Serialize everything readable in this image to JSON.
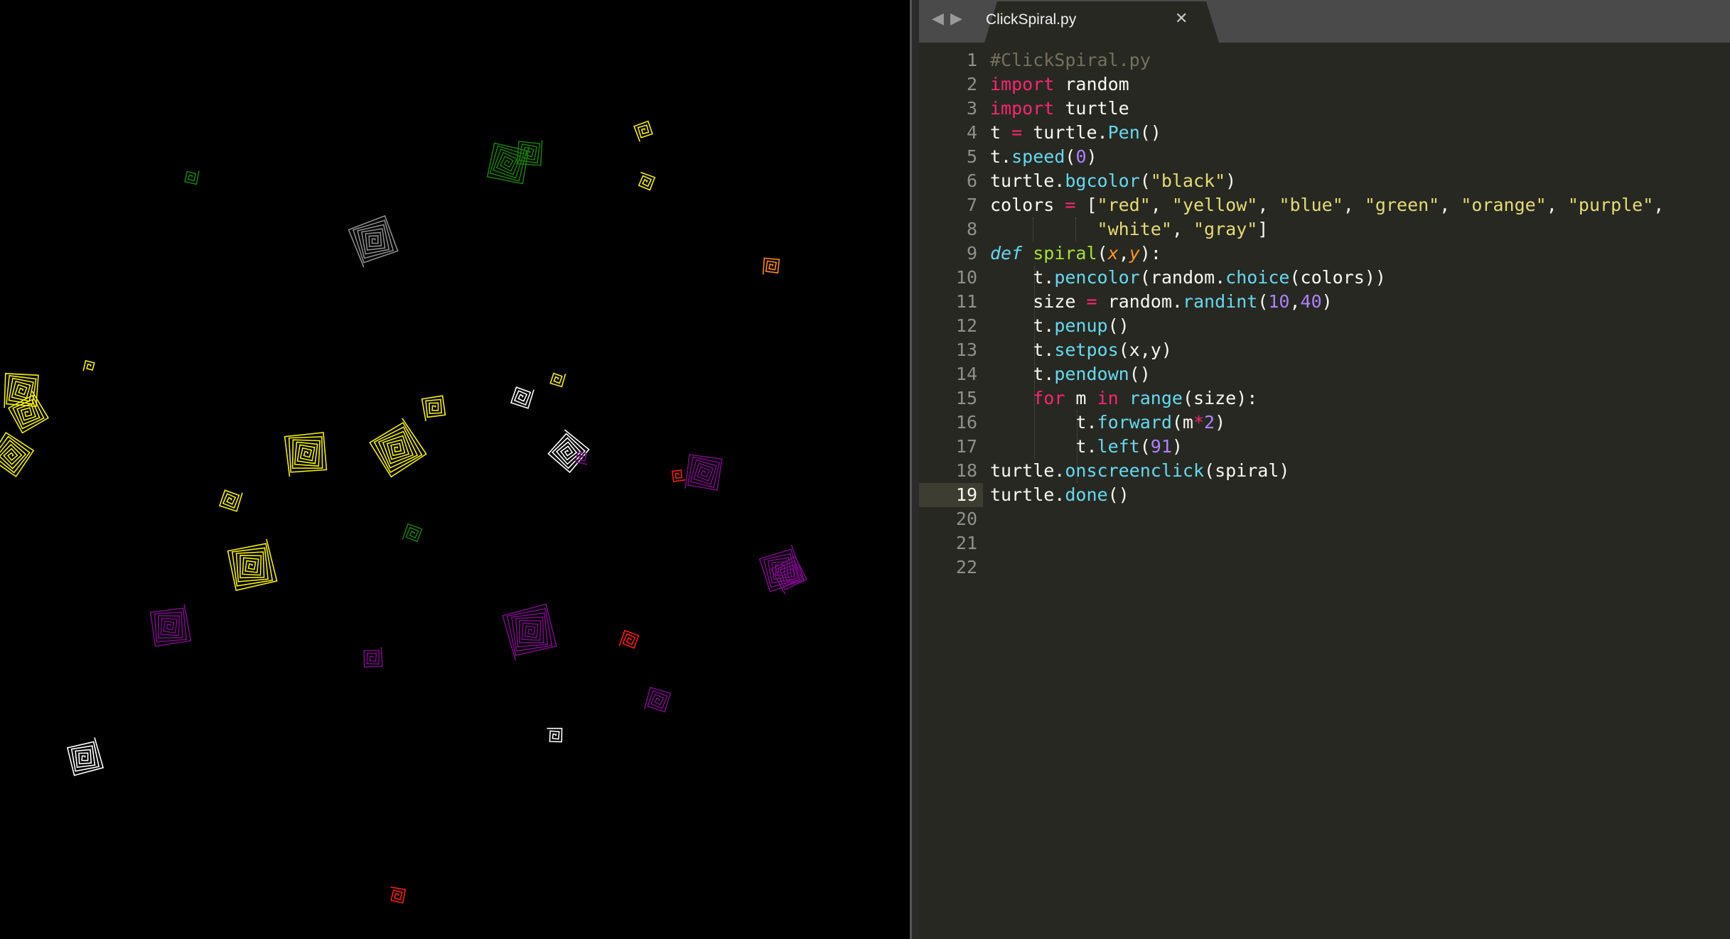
{
  "canvas": {
    "background": "#000000",
    "spiral_colors": {
      "red": "#ff1a1a",
      "yellow": "#f5f000",
      "green": "#1a7a0a",
      "orange": "#ff8c00",
      "purple": "#7a0a86",
      "white": "#ffffff",
      "gray": "#8c8c8c"
    }
  },
  "editor": {
    "tab": {
      "title": "ClickSpiral.py",
      "close_icon": "close-icon",
      "back_icon": "triangle-left-icon",
      "forward_icon": "triangle-right-icon"
    },
    "active_line": 19,
    "line_numbers": [
      "1",
      "2",
      "3",
      "4",
      "5",
      "6",
      "7",
      "8",
      "9",
      "10",
      "11",
      "12",
      "13",
      "14",
      "15",
      "16",
      "17",
      "18",
      "19",
      "20",
      "21",
      "22"
    ],
    "lines": [
      [
        [
          "comment",
          "#ClickSpiral.py"
        ]
      ],
      [
        [
          "keyword",
          "import"
        ],
        [
          "text",
          " random"
        ]
      ],
      [
        [
          "keyword",
          "import"
        ],
        [
          "text",
          " turtle"
        ]
      ],
      [
        [
          "text",
          "t "
        ],
        [
          "keyword",
          "="
        ],
        [
          "text",
          " turtle."
        ],
        [
          "func",
          "Pen"
        ],
        [
          "text",
          "()"
        ]
      ],
      [
        [
          "text",
          "t."
        ],
        [
          "func",
          "speed"
        ],
        [
          "text",
          "("
        ],
        [
          "number",
          "0"
        ],
        [
          "text",
          ")"
        ]
      ],
      [
        [
          "text",
          "turtle."
        ],
        [
          "func",
          "bgcolor"
        ],
        [
          "text",
          "("
        ],
        [
          "string",
          "\"black\""
        ],
        [
          "text",
          ")"
        ]
      ],
      [
        [
          "text",
          "colors "
        ],
        [
          "keyword",
          "="
        ],
        [
          "text",
          " ["
        ],
        [
          "string",
          "\"red\""
        ],
        [
          "text",
          ", "
        ],
        [
          "string",
          "\"yellow\""
        ],
        [
          "text",
          ", "
        ],
        [
          "string",
          "\"blue\""
        ],
        [
          "text",
          ", "
        ],
        [
          "string",
          "\"green\""
        ],
        [
          "text",
          ", "
        ],
        [
          "string",
          "\"orange\""
        ],
        [
          "text",
          ", "
        ],
        [
          "string",
          "\"purple\""
        ],
        [
          "text",
          ","
        ]
      ],
      [
        [
          "text",
          "          "
        ],
        [
          "string",
          "\"white\""
        ],
        [
          "text",
          ", "
        ],
        [
          "string",
          "\"gray\""
        ],
        [
          "text",
          "]"
        ]
      ],
      [
        [
          "storage",
          "def"
        ],
        [
          "text",
          " "
        ],
        [
          "defname",
          "spiral"
        ],
        [
          "text",
          "("
        ],
        [
          "param",
          "x"
        ],
        [
          "text",
          ","
        ],
        [
          "param",
          "y"
        ],
        [
          "text",
          "):"
        ]
      ],
      [
        [
          "text",
          "    t."
        ],
        [
          "func",
          "pencolor"
        ],
        [
          "text",
          "(random."
        ],
        [
          "func",
          "choice"
        ],
        [
          "text",
          "(colors))"
        ]
      ],
      [
        [
          "text",
          "    size "
        ],
        [
          "keyword",
          "="
        ],
        [
          "text",
          " random."
        ],
        [
          "func",
          "randint"
        ],
        [
          "text",
          "("
        ],
        [
          "number",
          "10"
        ],
        [
          "text",
          ","
        ],
        [
          "number",
          "40"
        ],
        [
          "text",
          ")"
        ]
      ],
      [
        [
          "text",
          "    t."
        ],
        [
          "func",
          "penup"
        ],
        [
          "text",
          "()"
        ]
      ],
      [
        [
          "text",
          "    t."
        ],
        [
          "func",
          "setpos"
        ],
        [
          "text",
          "(x,y)"
        ]
      ],
      [
        [
          "text",
          "    t."
        ],
        [
          "func",
          "pendown"
        ],
        [
          "text",
          "()"
        ]
      ],
      [
        [
          "text",
          "    "
        ],
        [
          "keyword",
          "for"
        ],
        [
          "text",
          " m "
        ],
        [
          "keyword",
          "in"
        ],
        [
          "text",
          " "
        ],
        [
          "func",
          "range"
        ],
        [
          "text",
          "(size):"
        ]
      ],
      [
        [
          "text",
          "        t."
        ],
        [
          "func",
          "forward"
        ],
        [
          "text",
          "(m"
        ],
        [
          "keyword",
          "*"
        ],
        [
          "number",
          "2"
        ],
        [
          "text",
          ")"
        ]
      ],
      [
        [
          "text",
          "        t."
        ],
        [
          "func",
          "left"
        ],
        [
          "text",
          "("
        ],
        [
          "number",
          "91"
        ],
        [
          "text",
          ")"
        ]
      ],
      [
        [
          "text",
          "turtle."
        ],
        [
          "func",
          "onscreenclick"
        ],
        [
          "text",
          "(spiral)"
        ]
      ],
      [
        [
          "text",
          "turtle."
        ],
        [
          "func",
          "done"
        ],
        [
          "text",
          "()"
        ]
      ],
      [],
      [],
      []
    ]
  }
}
